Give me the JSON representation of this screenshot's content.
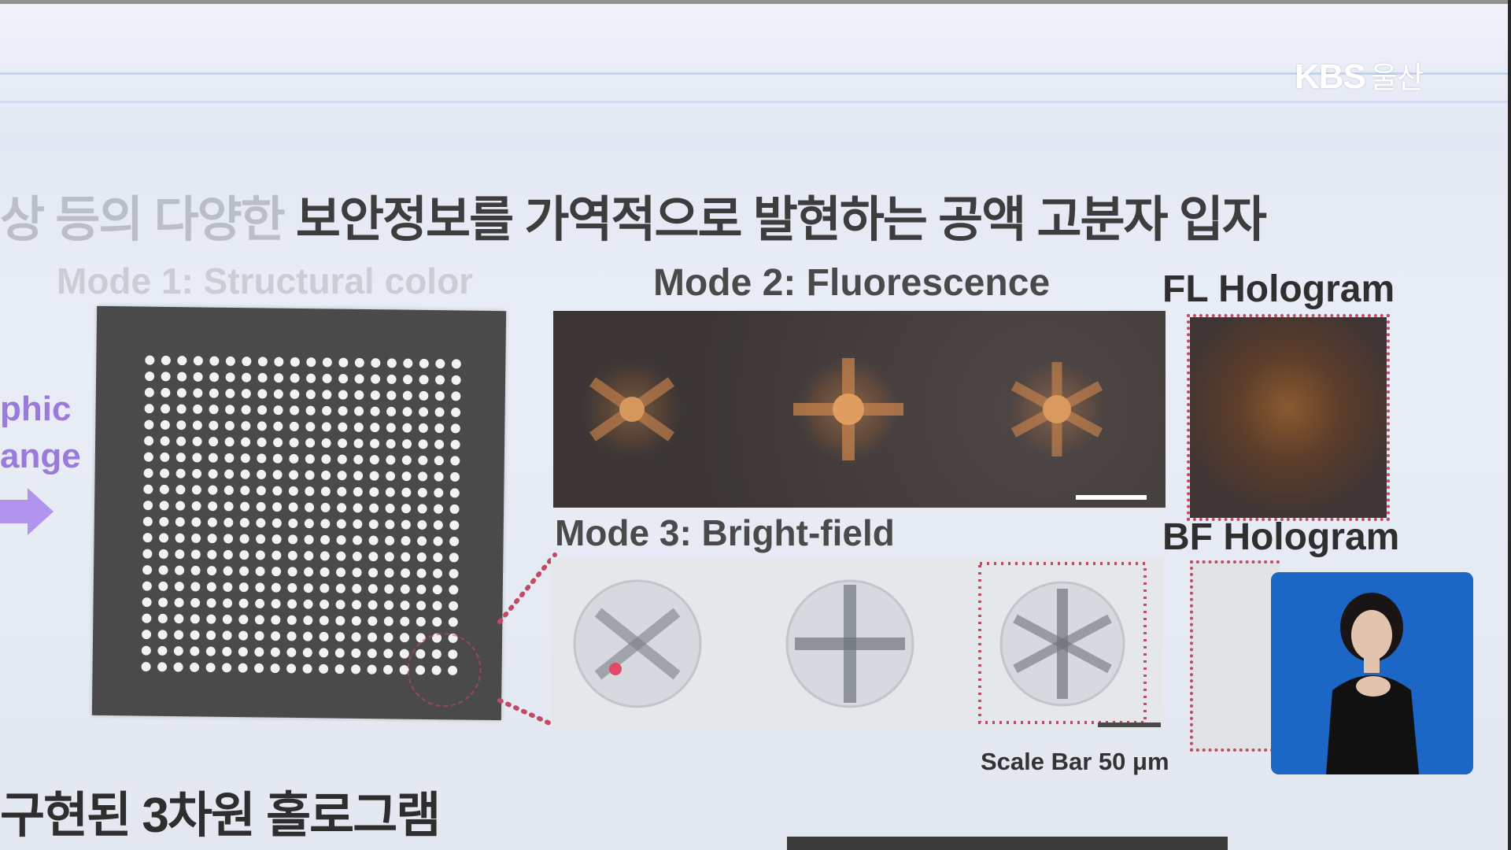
{
  "broadcast": {
    "logo": "KBS",
    "region": "울산"
  },
  "slide": {
    "heading_fade": "상 등의 다양한 ",
    "heading_main": "보안정보를 가역적으로 발현하는 공액 고분자 입자",
    "side_text_1": "phic",
    "side_text_2": "ange",
    "mode1_label": "Mode 1: Structural color",
    "mode2_label": "Mode 2: Fluorescence",
    "fl_hologram_label": "FL Hologram",
    "mode3_label": "Mode 3: Bright-field",
    "bf_hologram_label": "BF Hologram",
    "scale_bar_label": "Scale Bar 50 μm",
    "bottom_text": "구현된 3차원 홀로그램"
  },
  "colors": {
    "arrow": "#b293ee",
    "selection": "#c24a64",
    "signer_bg": "#1c67c6"
  }
}
